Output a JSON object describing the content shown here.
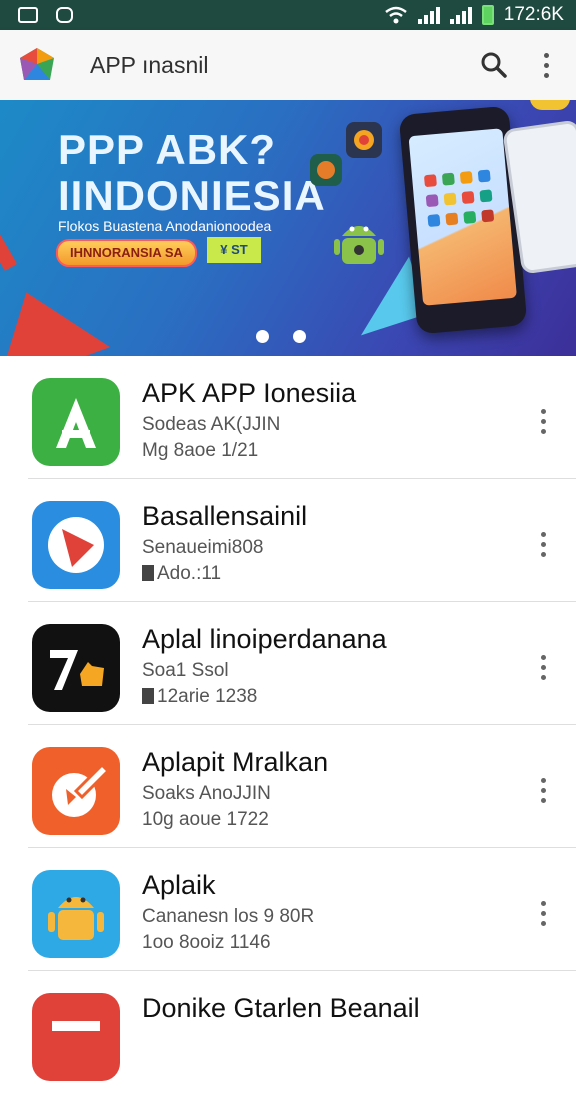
{
  "status_bar": {
    "time": "172:6K",
    "left_icons": [
      "gallery-icon",
      "notification-icon"
    ],
    "right_icons": [
      "wifi-icon",
      "signal-icon",
      "signal-icon",
      "battery-icon"
    ]
  },
  "app_bar": {
    "title": "APP ınasnil",
    "actions": [
      "search-icon",
      "more-vert-icon"
    ]
  },
  "banner": {
    "title_line1": "PPP ABK?",
    "title_line2": "IINDONIESIA",
    "subtitle": "Flokos Buastena Anodanionoodea",
    "pill_label": "IHNNORANSIA SA",
    "badge_label": "¥ ST",
    "page_dots": 2
  },
  "apps": [
    {
      "title": "APK APP Ionesiia",
      "subtitle": "Sodeas AK(JJIN",
      "meta": "Mg 8aoe 1/21",
      "icon": "green-a-icon"
    },
    {
      "title": "Basallensainil",
      "subtitle": "Senaueimi808",
      "meta": "Ado.:11",
      "icon": "red-play-icon"
    },
    {
      "title": "Aplal linoiperdanana",
      "subtitle": "Soa1 Ssol",
      "meta": "12arie 1238",
      "icon": "seven-hand-icon"
    },
    {
      "title": "Aplapit Mralkan",
      "subtitle": "Soaks AnoJJIN",
      "meta": "10g aoue 1722",
      "icon": "orange-edit-icon"
    },
    {
      "title": "Aplaik",
      "subtitle": "Cananesn los 9 80R",
      "meta": "1oo 8ooiz 1146",
      "icon": "android-icon"
    },
    {
      "title": "Donike Gtarlen Beanail",
      "subtitle": "",
      "meta": "",
      "icon": "red-app-icon"
    }
  ],
  "colors": {
    "status_bar": "#1f4a3f",
    "banner_start": "#1d8ac7",
    "banner_end": "#3c2f99"
  }
}
